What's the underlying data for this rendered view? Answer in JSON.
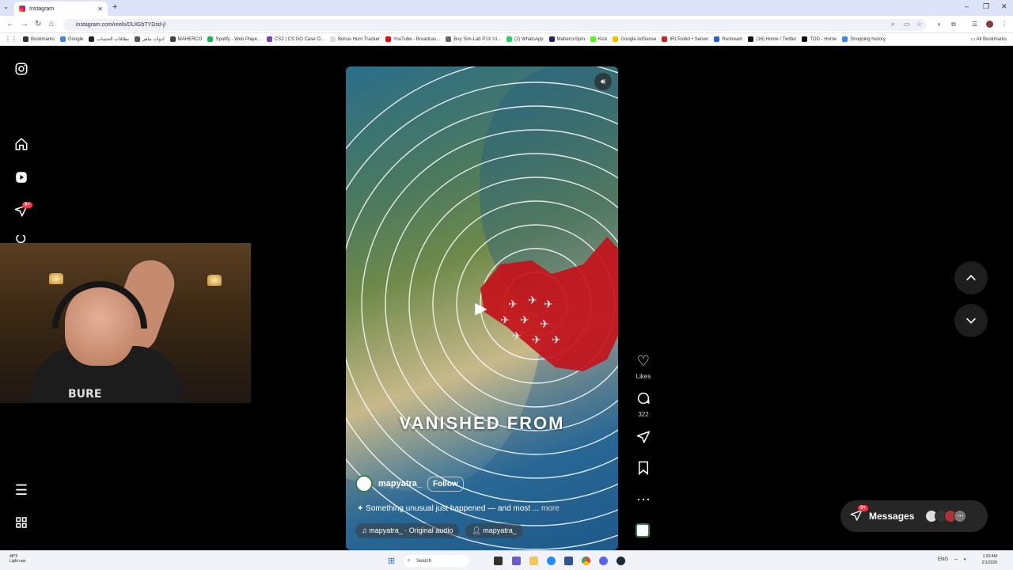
{
  "browser": {
    "tab_title": "Instagram",
    "url": "instagram.com/reels/DUIGbTYDsd-j/",
    "all_bookmarks": "All Bookmarks",
    "bookmarks": [
      {
        "label": "Bookmarks",
        "color": "#333333"
      },
      {
        "label": "Google",
        "color": "#4285f4"
      },
      {
        "label": "بطاقات الحساب",
        "color": "#222222"
      },
      {
        "label": "ادوات ماهر",
        "color": "#555555"
      },
      {
        "label": "MAHERCO",
        "color": "#444444"
      },
      {
        "label": "Spotify - Web Playe...",
        "color": "#1db954"
      },
      {
        "label": "CS2 | CS:GO Case O...",
        "color": "#7b3fbf"
      },
      {
        "label": "Bonus Hunt Tracker",
        "color": "#dddddd"
      },
      {
        "label": "YouTube - Broadcas...",
        "color": "#ff0000"
      },
      {
        "label": "Buy Sim-Lab P1X Ul...",
        "color": "#666666"
      },
      {
        "label": "(2) WhatsApp",
        "color": "#25d366"
      },
      {
        "label": "MahercoSpin",
        "color": "#222266"
      },
      {
        "label": "Kick",
        "color": "#53fc18"
      },
      {
        "label": "Google AdSense",
        "color": "#fbbc04"
      },
      {
        "label": "IRLToolkit • Server",
        "color": "#cc2222"
      },
      {
        "label": "Restream",
        "color": "#2a5bd7"
      },
      {
        "label": "(16) Home / Twitter",
        "color": "#111111"
      },
      {
        "label": "TOD - Home",
        "color": "#111111"
      },
      {
        "label": "Shopping history",
        "color": "#4285f4"
      }
    ]
  },
  "sidebar": {
    "notifications_badge": "9+"
  },
  "reel": {
    "overlay_text": "VANISHED FROM",
    "author": "mapyatra_",
    "follow_label": "Follow",
    "caption": "Something unusual just happened — and most ...",
    "more_label": "more",
    "audio_label": "mapyatra_ · Original audio",
    "tagged_user": "mapyatra_"
  },
  "actions": {
    "likes_label": "Likes",
    "comments_count": "322"
  },
  "messages": {
    "label": "Messages",
    "badge": "9+"
  },
  "taskbar": {
    "temperature": "48°F",
    "weather": "Light rain",
    "search_placeholder": "Search",
    "lang": "ENG",
    "time": "1:33 AM",
    "date": "2/1/2026"
  }
}
